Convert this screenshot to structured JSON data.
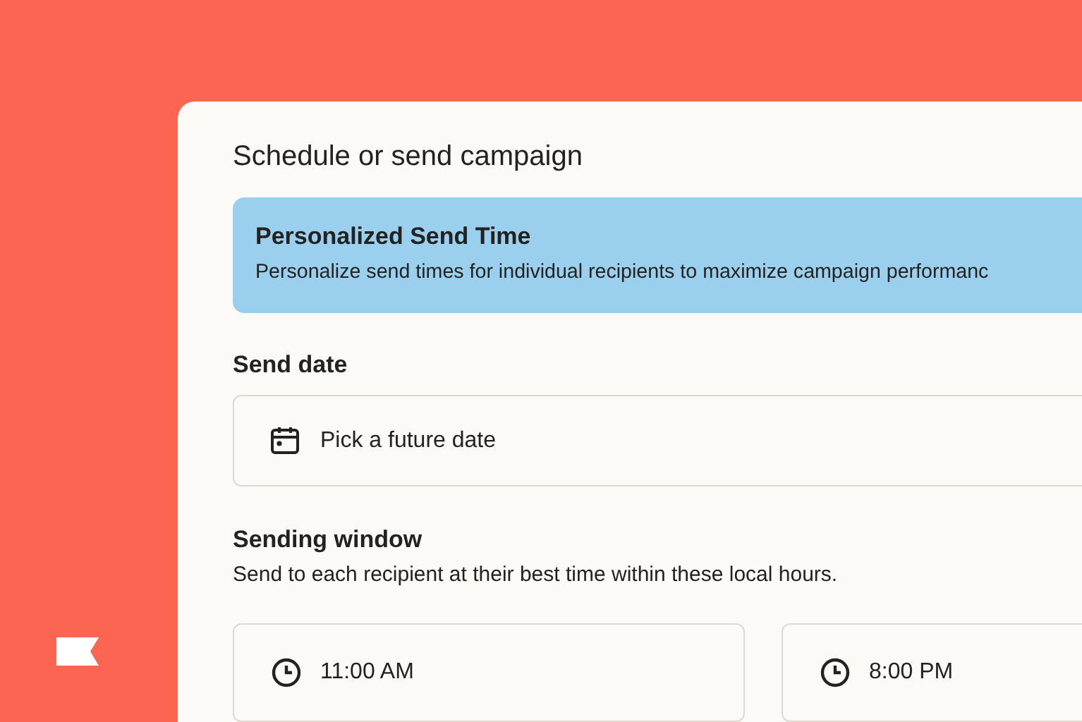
{
  "panel": {
    "title": "Schedule or send campaign",
    "banner": {
      "title": "Personalized Send Time",
      "description": "Personalize send times for individual recipients to maximize campaign performanc"
    },
    "send_date": {
      "label": "Send date",
      "placeholder": "Pick a future date"
    },
    "sending_window": {
      "label": "Sending window",
      "description": "Send to each recipient at their best time within these local hours.",
      "times": [
        {
          "value": "11:00 AM"
        },
        {
          "value": "8:00 PM"
        }
      ]
    }
  }
}
